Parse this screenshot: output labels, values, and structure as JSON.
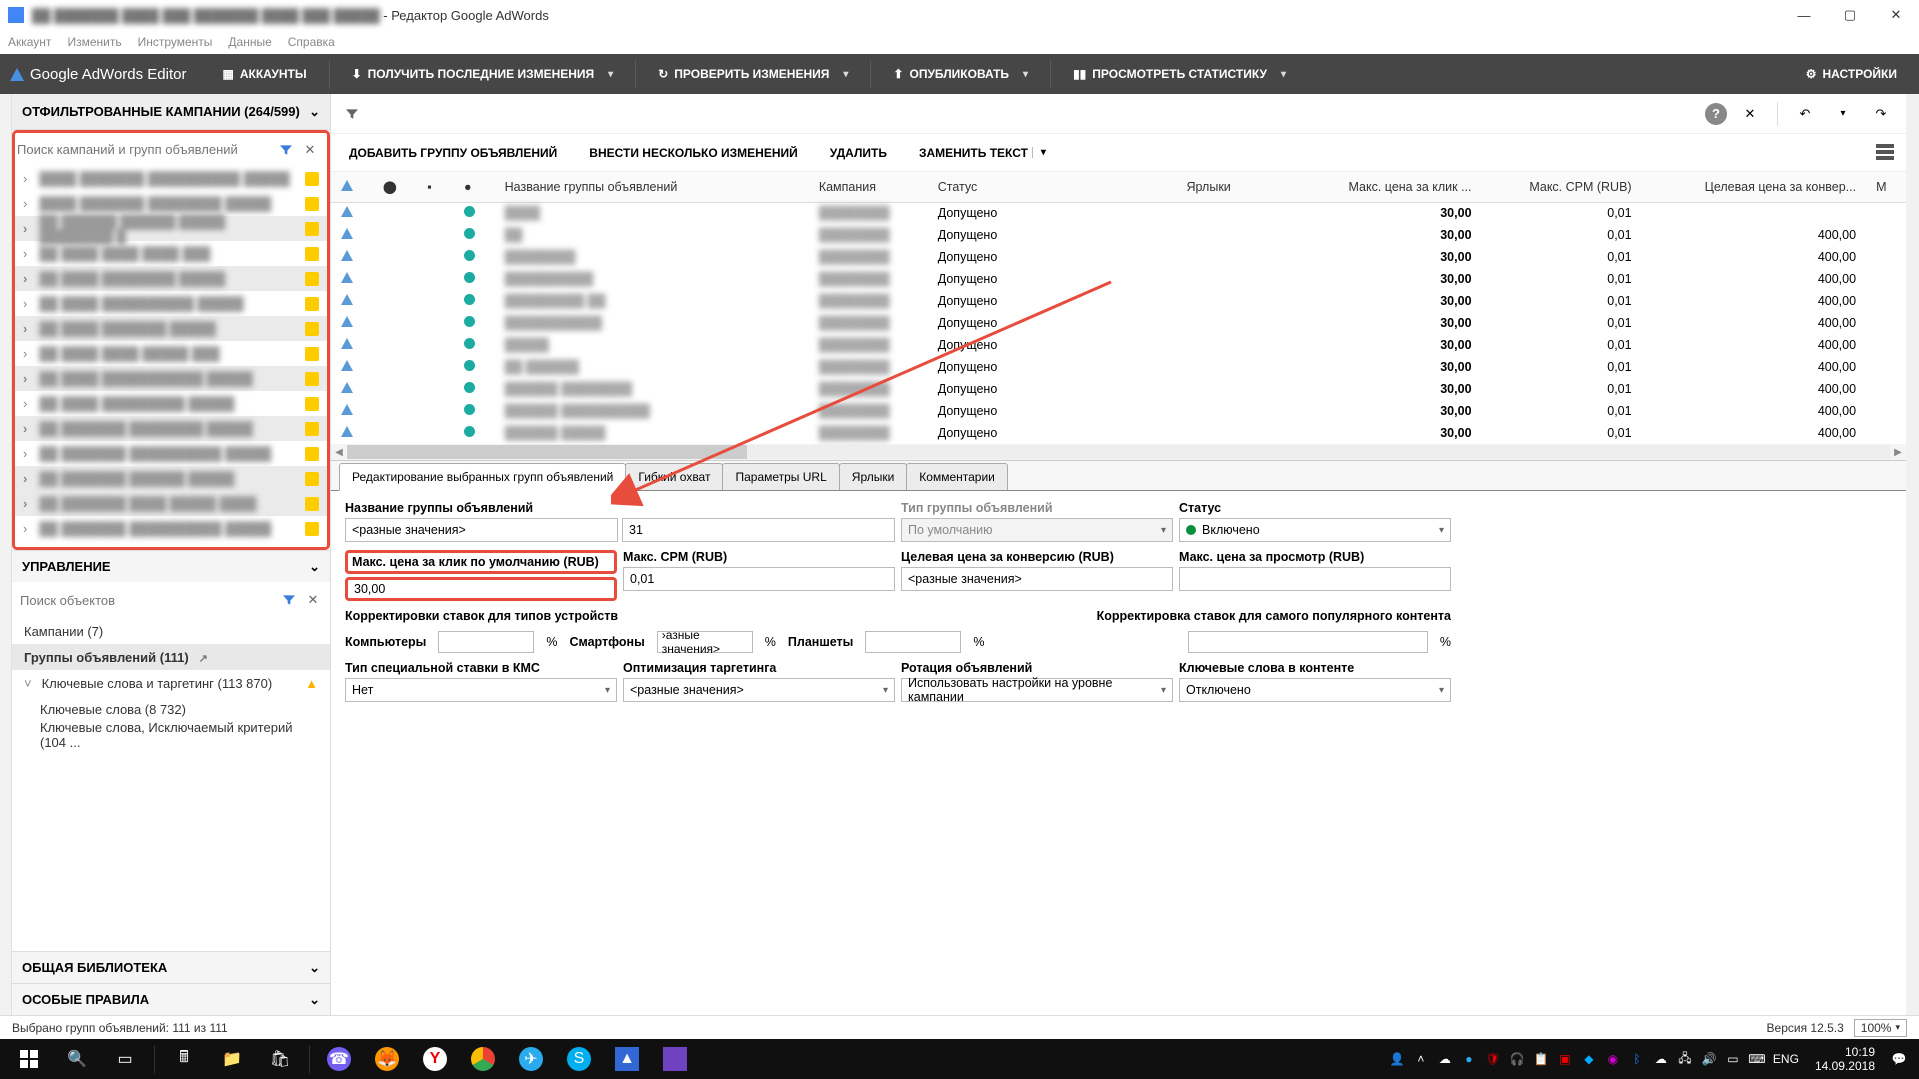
{
  "window": {
    "title_blur": "██ ███████ ████ ███ ███████ ████ ███ █████",
    "title_suffix": " - Редактор Google AdWords",
    "min": "—",
    "max": "▢",
    "close": "✕"
  },
  "menubar": [
    "Аккаунт",
    "Изменить",
    "Инструменты",
    "Данные",
    "Справка"
  ],
  "dark": {
    "logo": "Google AdWords Editor",
    "accounts": "АККАУНТЫ",
    "fetch": "ПОЛУЧИТЬ ПОСЛЕДНИЕ ИЗМЕНЕНИЯ",
    "check": "ПРОВЕРИТЬ ИЗМЕНЕНИЯ",
    "publish": "ОПУБЛИКОВАТЬ",
    "stats": "ПРОСМОТРЕТЬ СТАТИСТИКУ",
    "settings": "НАСТРОЙКИ"
  },
  "sidebar": {
    "filtered_header": "ОТФИЛЬТРОВАННЫЕ КАМПАНИИ (264/599)",
    "search_placeholder": "Поиск кампаний и групп объявлений",
    "campaigns": [
      {
        "sel": false,
        "txt": "████ ███████ ██████████ █████"
      },
      {
        "sel": false,
        "txt": "████ ███████ ████████ █████"
      },
      {
        "sel": true,
        "txt": "██ ██████ ██████ █████ ████████ █"
      },
      {
        "sel": false,
        "txt": "██ ████ ████ ████ ███"
      },
      {
        "sel": true,
        "txt": "██ ████ ████████ █████"
      },
      {
        "sel": false,
        "txt": "██ ████ ██████████ █████"
      },
      {
        "sel": true,
        "txt": "██ ████ ███████ █████"
      },
      {
        "sel": false,
        "txt": "██ ████ ████ █████ ███"
      },
      {
        "sel": true,
        "txt": "██ ████ ███████████ █████"
      },
      {
        "sel": false,
        "txt": "██ ████ █████████ █████"
      },
      {
        "sel": true,
        "txt": "██ ███████ ████████ █████"
      },
      {
        "sel": false,
        "txt": "██ ███████ ██████████ █████"
      },
      {
        "sel": true,
        "txt": "██ ███████ ██████ █████"
      },
      {
        "sel": true,
        "txt": "██ ███████ ████ █████ ████"
      },
      {
        "sel": false,
        "txt": "██ ███████ ██████████ █████"
      }
    ],
    "management": "УПРАВЛЕНИЕ",
    "obj_search_placeholder": "Поиск объектов",
    "objects": {
      "campaigns": "Кампании (7)",
      "adgroups": "Группы объявлений (111)",
      "keywords_target": "Ключевые слова и таргетинг (113 870)",
      "keywords": "Ключевые слова (8 732)",
      "neg_keywords": "Ключевые слова, Исключаемый критерий (104 ..."
    },
    "library": "ОБЩАЯ БИБЛИОТЕКА",
    "rules": "ОСОБЫЕ ПРАВИЛА"
  },
  "actions": {
    "add": "ДОБАВИТЬ ГРУППУ ОБЪЯВЛЕНИЙ",
    "multi": "ВНЕСТИ НЕСКОЛЬКО ИЗМЕНЕНИЙ",
    "del": "УДАЛИТЬ",
    "replace": "ЗАМЕНИТЬ ТЕКСТ"
  },
  "table": {
    "headers": {
      "name": "Название группы объявлений",
      "campaign": "Кампания",
      "status": "Статус",
      "labels": "Ярлыки",
      "cpc": "Макс. цена за клик ...",
      "cpm": "Макс. CPM (RUB)",
      "cpa": "Целевая цена за конвер...",
      "m": "М"
    },
    "rows": [
      {
        "name": "████",
        "camp": "████████",
        "status": "Допущено",
        "cpc": "30,00",
        "cpm": "0,01",
        "cpa": ""
      },
      {
        "name": "██",
        "camp": "████████",
        "status": "Допущено",
        "cpc": "30,00",
        "cpm": "0,01",
        "cpa": "400,00"
      },
      {
        "name": "████████",
        "camp": "████████",
        "status": "Допущено",
        "cpc": "30,00",
        "cpm": "0,01",
        "cpa": "400,00"
      },
      {
        "name": "██████████",
        "camp": "████████",
        "status": "Допущено",
        "cpc": "30,00",
        "cpm": "0,01",
        "cpa": "400,00"
      },
      {
        "name": "█████████ ██",
        "camp": "████████",
        "status": "Допущено",
        "cpc": "30,00",
        "cpm": "0,01",
        "cpa": "400,00"
      },
      {
        "name": "███████████",
        "camp": "████████",
        "status": "Допущено",
        "cpc": "30,00",
        "cpm": "0,01",
        "cpa": "400,00"
      },
      {
        "name": "█████",
        "camp": "████████",
        "status": "Допущено",
        "cpc": "30,00",
        "cpm": "0,01",
        "cpa": "400,00"
      },
      {
        "name": "██ ██████",
        "camp": "████████",
        "status": "Допущено",
        "cpc": "30,00",
        "cpm": "0,01",
        "cpa": "400,00"
      },
      {
        "name": "██████ ████████",
        "camp": "████████",
        "status": "Допущено",
        "cpc": "30,00",
        "cpm": "0,01",
        "cpa": "400,00"
      },
      {
        "name": "██████ ██████████",
        "camp": "████████",
        "status": "Допущено",
        "cpc": "30,00",
        "cpm": "0,01",
        "cpa": "400,00"
      },
      {
        "name": "██████ █████",
        "camp": "████████",
        "status": "Допущено",
        "cpc": "30,00",
        "cpm": "0,01",
        "cpa": "400,00"
      }
    ]
  },
  "edit": {
    "tabs": [
      "Редактирование выбранных групп объявлений",
      "Гибкий охват",
      "Параметры URL",
      "Ярлыки",
      "Комментарии"
    ],
    "labels": {
      "name": "Название группы объявлений",
      "type": "Тип группы объявлений",
      "status": "Статус",
      "cpc": "Макс. цена за клик по умолчанию (RUB)",
      "cpm": "Макс. CPM (RUB)",
      "cpa": "Целевая цена за конверсию (RUB)",
      "cpv": "Макс. цена за просмотр (RUB)",
      "dev_adj": "Корректировки ставок для типов устройств",
      "content_adj": "Корректировка ставок для самого популярного контента",
      "computers": "Компьютеры",
      "phones": "Смартфоны",
      "tablets": "Планшеты",
      "kms_type": "Тип специальной ставки в КМС",
      "targeting": "Оптимизация таргетинга",
      "rotation": "Ротация объявлений",
      "kw_content": "Ключевые слова в контенте"
    },
    "values": {
      "name": "<разные значения>",
      "count": "31",
      "type": "По умолчанию",
      "status": "Включено",
      "cpc": "30,00",
      "cpm": "0,01",
      "cpa": "<разные значения>",
      "cpv": "",
      "computers": "",
      "phones": "›азные значения>",
      "tablets": "",
      "content_adj": "",
      "kms_type": "Нет",
      "targeting": "<разные значения>",
      "rotation": "Использовать настройки на уровне кампании",
      "kw_content": "Отключено"
    },
    "pct": "%"
  },
  "statusbar": {
    "selected": "Выбрано групп объявлений: 111 из 111",
    "version": "Версия 12.5.3",
    "zoom": "100%"
  },
  "taskbar": {
    "lang": "ENG",
    "time": "10:19",
    "date": "14.09.2018"
  }
}
